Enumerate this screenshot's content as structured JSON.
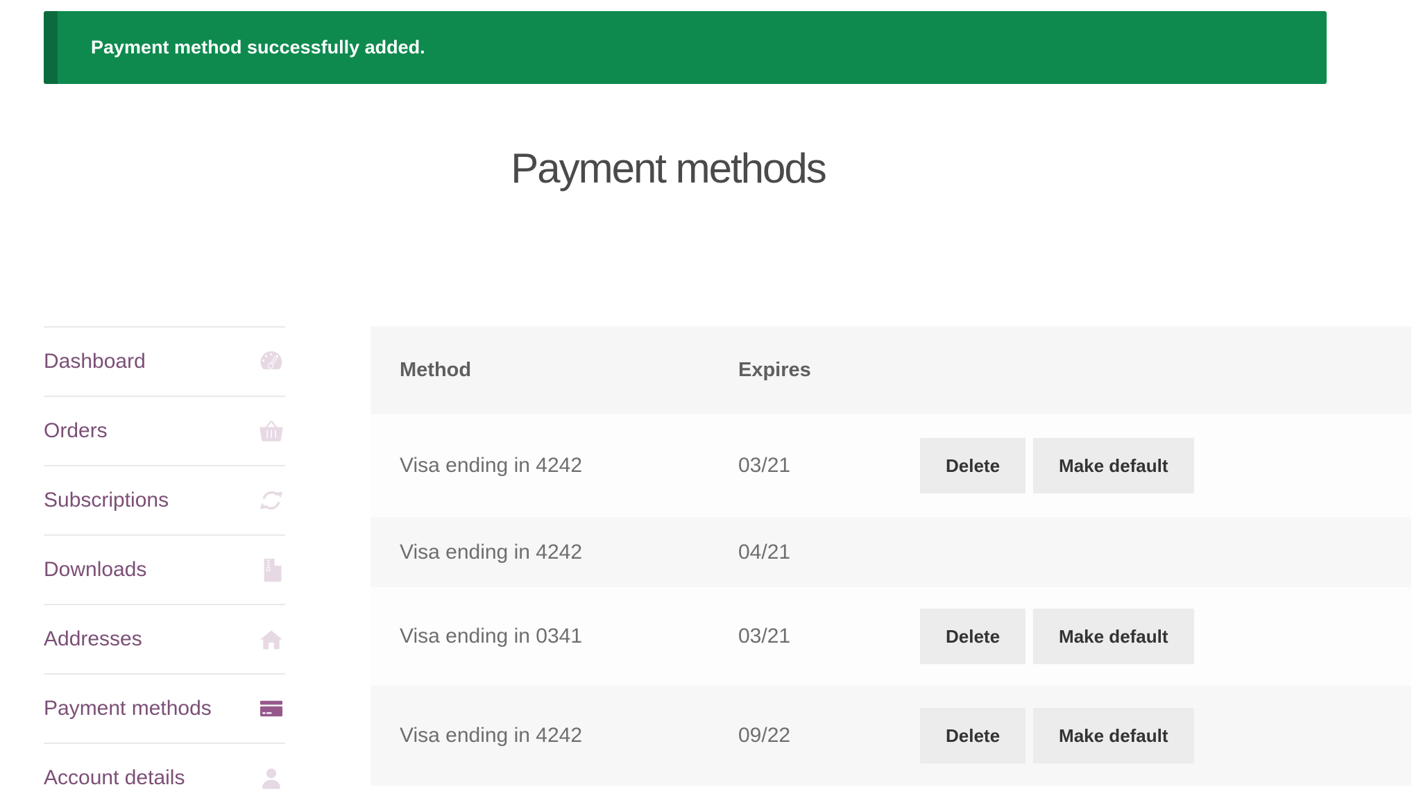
{
  "banner": {
    "message": "Payment method successfully added."
  },
  "page": {
    "title": "Payment methods"
  },
  "sidebar": {
    "items": [
      {
        "label": "Dashboard",
        "icon": "dashboard-gauge-icon",
        "active": false
      },
      {
        "label": "Orders",
        "icon": "shopping-basket-icon",
        "active": false
      },
      {
        "label": "Subscriptions",
        "icon": "sync-icon",
        "active": false
      },
      {
        "label": "Downloads",
        "icon": "file-archive-icon",
        "active": false
      },
      {
        "label": "Addresses",
        "icon": "home-icon",
        "active": false
      },
      {
        "label": "Payment methods",
        "icon": "credit-card-icon",
        "active": true
      },
      {
        "label": "Account details",
        "icon": "user-icon",
        "active": false
      }
    ]
  },
  "table": {
    "columns": [
      "Method",
      "Expires"
    ],
    "rows": [
      {
        "method": "Visa ending in 4242",
        "expires": "03/21",
        "actions": [
          "Delete",
          "Make default"
        ]
      },
      {
        "method": "Visa ending in 4242",
        "expires": "04/21",
        "actions": []
      },
      {
        "method": "Visa ending in 0341",
        "expires": "03/21",
        "actions": [
          "Delete",
          "Make default"
        ]
      },
      {
        "method": "Visa ending in 4242",
        "expires": "09/22",
        "actions": [
          "Delete",
          "Make default"
        ]
      }
    ]
  },
  "colors": {
    "banner_green": "#0f8a4f",
    "banner_green_dark": "#0c6b3e",
    "accent_purple": "#96588a",
    "sidebar_link_purple": "#7c4f76",
    "icon_pale": "#e7d9e4",
    "table_header_bg": "#f6f6f6",
    "row_bg": "#fdfdfd",
    "row_alt_bg": "#f7f7f7",
    "button_bg": "#ececec",
    "button_text": "#333333"
  }
}
